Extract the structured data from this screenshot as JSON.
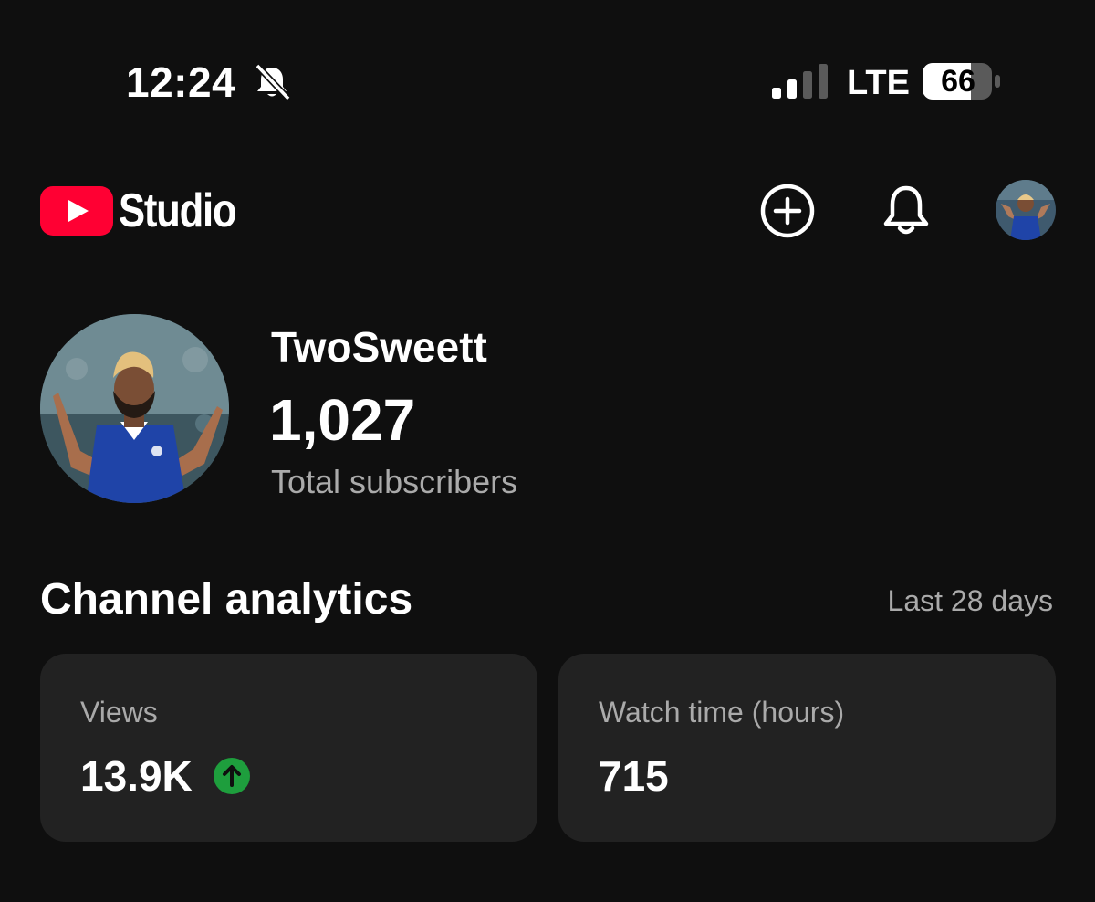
{
  "status_bar": {
    "time": "12:24",
    "network": "LTE",
    "battery": "66",
    "icons": [
      "bell-slash-icon",
      "signal-icon",
      "battery-icon"
    ]
  },
  "header": {
    "app_name": "Studio",
    "logo_icon": "youtube-play-icon",
    "brand_color": "#ff0033",
    "actions": [
      "create-plus-icon",
      "notification-bell-icon",
      "account-avatar"
    ]
  },
  "channel": {
    "name": "TwoSweett",
    "subscriber_count": "1,027",
    "subscriber_label": "Total subscribers"
  },
  "analytics": {
    "title": "Channel analytics",
    "range": "Last 28 days",
    "cards": [
      {
        "label": "Views",
        "value": "13.9K",
        "trend": "up",
        "trend_color": "#1e9e3d"
      },
      {
        "label": "Watch time (hours)",
        "value": "715"
      }
    ]
  }
}
